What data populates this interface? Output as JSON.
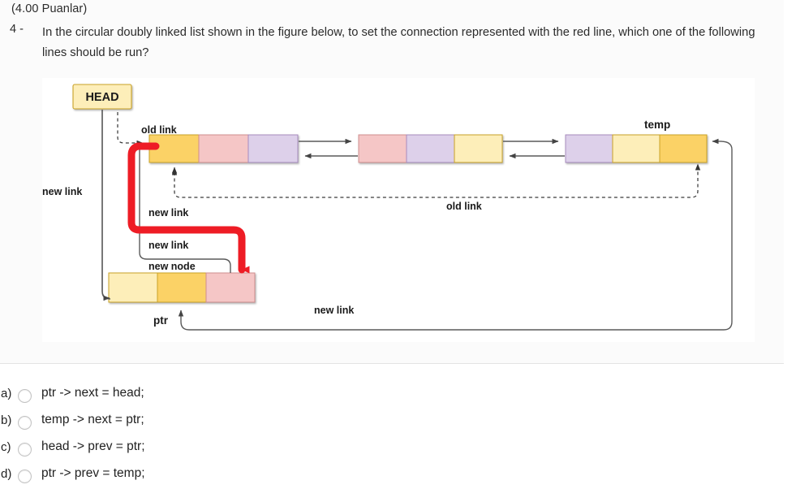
{
  "question": {
    "points": "(4.00 Puanlar)",
    "number": "4 -",
    "text": "In the circular doubly linked list shown in the figure below, to set the connection represented with the red line, which one of the following lines should be run?"
  },
  "figure": {
    "head_box": "HEAD",
    "temp_label": "temp",
    "ptr_label": "ptr",
    "labels": {
      "old_link_head": "old link",
      "new_link_left": "new link",
      "new_link_red": "new link",
      "new_link_mid": "new link",
      "new_node": "new node",
      "old_link_bottom": "old link",
      "new_link_bottom": "new link"
    },
    "colors": {
      "gold": "#fbd266",
      "light_yellow": "#fdeeb9",
      "pink": "#f5c6c6",
      "purple": "#ddd0ea",
      "head_fill": "#fdeeb9",
      "node_stroke_gold": "#c9a227",
      "node_stroke_pink": "#cf8f8f",
      "node_stroke_purple": "#a78bbd",
      "line": "#5a5a5a",
      "red": "#ee1c25"
    },
    "nodes": [
      {
        "name": "node-1",
        "cells": [
          "gold",
          "pink",
          "purple"
        ]
      },
      {
        "name": "node-2",
        "cells": [
          "pink",
          "purple",
          "light_yellow"
        ]
      },
      {
        "name": "node-3-temp",
        "cells": [
          "purple",
          "light_yellow",
          "gold"
        ]
      },
      {
        "name": "new-node",
        "cells": [
          "light_yellow",
          "gold",
          "pink"
        ]
      }
    ]
  },
  "options": [
    {
      "letter": "a)",
      "text": "ptr -> next = head;"
    },
    {
      "letter": "b)",
      "text": "temp -> next = ptr;"
    },
    {
      "letter": "c)",
      "text": "head -> prev = ptr;"
    },
    {
      "letter": "d)",
      "text": "ptr -> prev = temp;"
    }
  ]
}
